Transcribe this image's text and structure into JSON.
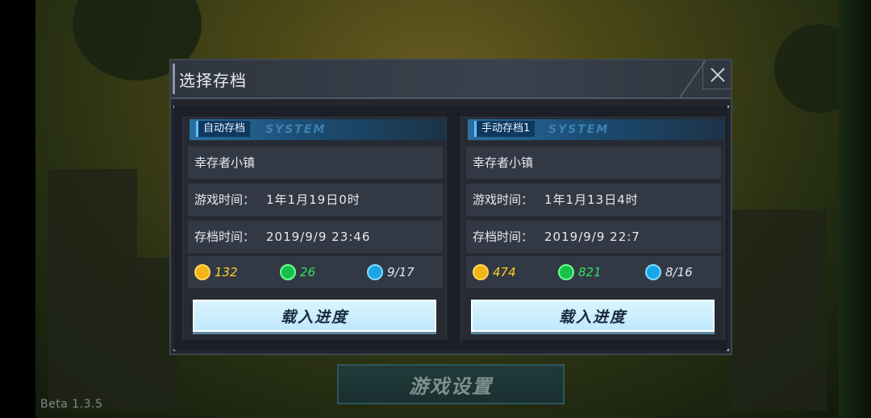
{
  "version": "Beta 1.3.5",
  "settings_button": "游戏设置",
  "dialog": {
    "title": "选择存档",
    "close_icon": "close-icon"
  },
  "saves": [
    {
      "tab_label": "自动存档",
      "tab_watermark": "SYSTEM",
      "location": "幸存者小镇",
      "game_time_label": "游戏时间：",
      "game_time": "1年1月19日0时",
      "save_time_label": "存档时间：",
      "save_time": "2019/9/9   23:46",
      "coins": "132",
      "energy": "26",
      "survivors": "9/17",
      "load_button": "载入进度"
    },
    {
      "tab_label": "手动存档1",
      "tab_watermark": "SYSTEM",
      "location": "幸存者小镇",
      "game_time_label": "游戏时间：",
      "game_time": "1年1月13日4时",
      "save_time_label": "存档时间：",
      "save_time": "2019/9/9   22:7",
      "coins": "474",
      "energy": "821",
      "survivors": "8/16",
      "load_button": "载入进度"
    }
  ],
  "colors": {
    "coin": "#ffce2d",
    "energy": "#34e06a",
    "accent_blue": "#5fc3ff",
    "button_bg": "#c9ecfc"
  }
}
